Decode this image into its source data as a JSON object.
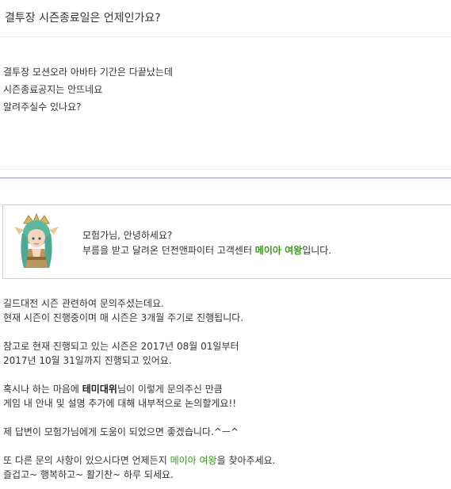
{
  "question": {
    "title": "결투장 시즌종료일은 언제인가요?",
    "body_lines": [
      "결투장 모션오라 아바타 기간은 다끝났는데",
      "시즌종료공지는 안뜨네요",
      "알려주실수 있나요?"
    ]
  },
  "answer": {
    "greeting_line1": "모험가님, 안녕하세요?",
    "greeting_line2_prefix": "부름을 받고 달려온 던전앤파이터 고객센터 ",
    "agent_name": "메이아 여왕",
    "greeting_line2_suffix": "입니다.",
    "p1_line1": "길드대전 시즌 관련하여 문의주셨는데요.",
    "p1_line2": "현재 시즌이 진행중이며 매 시즌은 3개월 주기로 진행됩니다.",
    "p2_line1": "참고로 현재 진행되고 있는 시즌은 2017년 08월 01일부터",
    "p2_line2": "2017년 10월 31일까지 진행되고 있어요.",
    "p3_line1_prefix": "혹시나 하는 마음에 ",
    "user_name": "테미대위",
    "p3_line1_suffix": "님이 이렇게 문의주신 만큼",
    "p3_line2": "게임 내 안내 및 설명 추가에 대해 내부적으로 논의할게요!!",
    "p4_line1": "제 답변이 모험가님에게 도움이 되었으면 좋겠습니다.^ㅡ^",
    "p5_line1_prefix": "또 다른 문의 사항이 있으시다면 언제든지 ",
    "p5_agent_name": "메이아 여왕",
    "p5_line1_suffix": "을 찾아주세요.",
    "p5_line2": "즐겁고~ 행복하고~ 활기찬~ 하루 되세요."
  },
  "colors": {
    "accent_green": "#3a9a19",
    "divider": "#8f9aa8"
  },
  "icons": {
    "avatar": "queen-meia-avatar"
  }
}
